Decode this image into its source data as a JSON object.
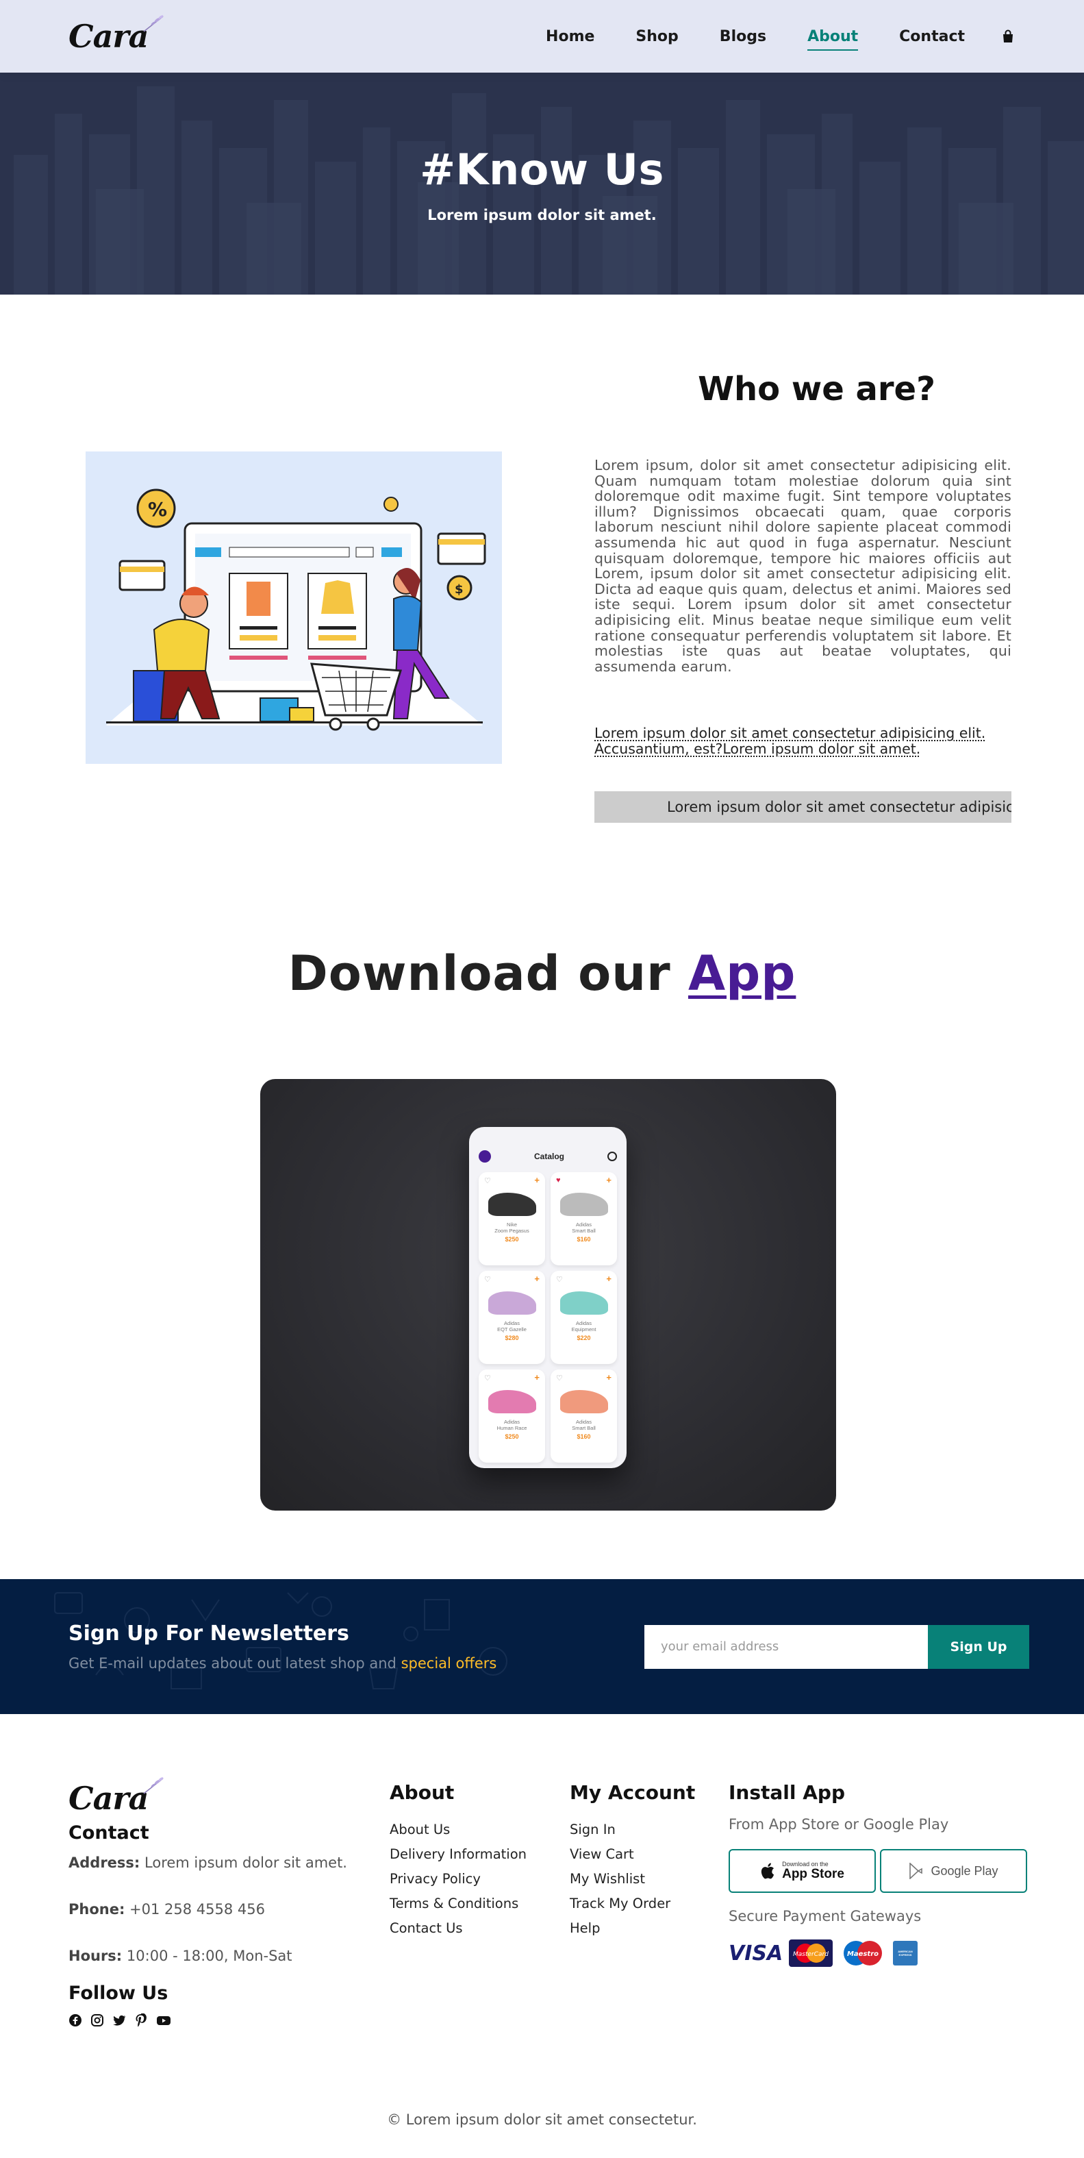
{
  "header": {
    "logo": "Cara",
    "nav": [
      "Home",
      "Shop",
      "Blogs",
      "About",
      "Contact"
    ],
    "active": "About"
  },
  "hero": {
    "title": "#Know Us",
    "subtitle": "Lorem ipsum dolor sit amet."
  },
  "about": {
    "heading": "Who we are?",
    "paragraph": "Lorem ipsum, dolor sit amet consectetur adipisicing elit. Quam numquam totam molestiae dolorum quia sint doloremque odit maxime fugit. Sint tempore voluptates illum? Dignissimos obcaecati quam, quae corporis laborum nesciunt nihil dolore sapiente placeat commodi assumenda hic aut quod in fuga aspernatur. Nesciunt quisquam doloremque, tempore hic maiores officiis aut Lorem, ipsum dolor sit amet consectetur adipisicing elit. Dicta ad eaque quis quam, delectus et animi. Maiores sed iste sequi. Lorem ipsum dolor sit amet consectetur adipisicing elit. Minus beatae neque similique eum velit ratione consequatur perferendis voluptatem sit labore. Et molestias iste quas aut beatae voluptates, qui assumenda earum.",
    "abbr": "Lorem ipsum dolor sit amet consectetur adipisicing elit. Accusantium, est?Lorem ipsum dolor sit amet.",
    "marquee": "Lorem ipsum dolor sit amet consectetur adipisicing elit."
  },
  "app": {
    "title_prefix": "Download our",
    "title_link": "App",
    "catalog_title": "Catalog",
    "products": [
      {
        "name": "Nike\nZoom Pegasus",
        "price": "$250",
        "fav": false,
        "color": "#333"
      },
      {
        "name": "Adidas\nSmart Ball",
        "price": "$160",
        "fav": true,
        "color": "#bbb"
      },
      {
        "name": "Adidas\nEQT Gazelle",
        "price": "$280",
        "fav": false,
        "color": "#c9a8d8"
      },
      {
        "name": "Adidas\nEquipment",
        "price": "$220",
        "fav": false,
        "color": "#7fd0c8"
      },
      {
        "name": "Adidas\nHuman Race",
        "price": "$250",
        "fav": false,
        "color": "#e37bb0"
      },
      {
        "name": "Adidas\nSmart Ball",
        "price": "$160",
        "fav": false,
        "color": "#f09a7d"
      }
    ]
  },
  "newsletter": {
    "heading": "Sign Up For Newsletters",
    "text": "Get E-mail updates about out latest shop and",
    "highlight": "special offers",
    "placeholder": "your email address",
    "button": "Sign Up"
  },
  "footer": {
    "logo": "Cara",
    "contact_heading": "Contact",
    "address_label": "Address:",
    "address": "Lorem ipsum dolor sit amet.",
    "phone_label": "Phone:",
    "phone": "+01 258 4558 456",
    "hours_label": "Hours:",
    "hours": "10:00 - 18:00, Mon-Sat",
    "follow_heading": "Follow Us",
    "about_heading": "About",
    "about_links": [
      "About Us",
      "Delivery Information",
      "Privacy Policy",
      "Terms & Conditions",
      "Contact Us"
    ],
    "account_heading": "My Account",
    "account_links": [
      "Sign In",
      "View Cart",
      "My Wishlist",
      "Track My Order",
      "Help"
    ],
    "install_heading": "Install App",
    "install_text": "From App Store or Google Play",
    "appstore_small": "Download on the",
    "appstore_big": "App Store",
    "googleplay": "Google Play",
    "payment_text": "Secure Payment Gateways",
    "visa": "VISA",
    "mastercard": "MasterCard",
    "maestro": "Maestro",
    "amex": "AMERICAN EXPRESS",
    "copyright": "© Lorem ipsum dolor sit amet consectetur."
  }
}
